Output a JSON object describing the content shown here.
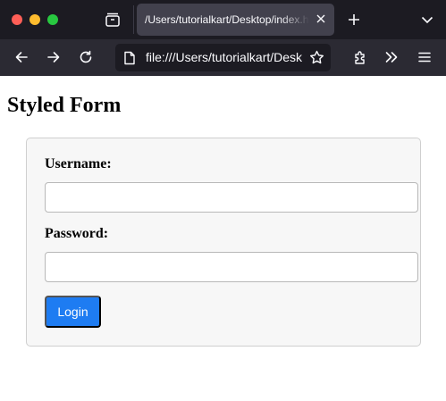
{
  "browser": {
    "tab": {
      "title": "/Users/tutorialkart/Desktop/index.html"
    },
    "url": "file:///Users/tutorialkart/Desktop/index.html",
    "icons": {
      "tab_list": "tab-list-icon",
      "tab_close": "close-icon",
      "new_tab": "plus-icon",
      "tab_overflow": "chevron-down-icon",
      "back": "back-arrow-icon",
      "forward": "forward-arrow-icon",
      "reload": "reload-icon",
      "page": "page-icon",
      "bookmark": "star-icon",
      "extensions": "puzzle-icon",
      "more_tools": "double-chevron-icon",
      "menu": "hamburger-menu-icon"
    },
    "colors": {
      "tab_strip": "#1c1b22",
      "toolbar": "#2b2a33",
      "active_tab": "#42414d",
      "close": "#ff5f57",
      "minimize": "#febc2e",
      "maximize": "#28c840"
    }
  },
  "page": {
    "title": "Styled Form",
    "form": {
      "username_label": "Username:",
      "username_value": "",
      "password_label": "Password:",
      "password_value": "",
      "submit_label": "Login"
    },
    "colors": {
      "form_background": "#f7f7f7",
      "button": "#1e7cf2",
      "button_text": "#ffffff"
    }
  }
}
